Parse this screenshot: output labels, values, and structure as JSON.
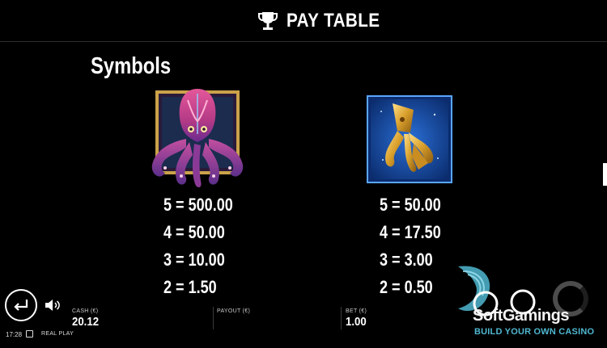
{
  "header": {
    "title": "PAY TABLE",
    "trophy_icon": "trophy-icon"
  },
  "section": {
    "title": "Symbols"
  },
  "symbols": [
    {
      "name": "kraken",
      "image_icon": "kraken-symbol",
      "pays": [
        {
          "text": "5 = 500.00"
        },
        {
          "text": "4 = 50.00"
        },
        {
          "text": "3 = 10.00"
        },
        {
          "text": "2 = 1.50"
        }
      ]
    },
    {
      "name": "gold squid",
      "image_icon": "gold-squid-symbol",
      "pays": [
        {
          "text": "5 = 50.00"
        },
        {
          "text": "4 = 17.50"
        },
        {
          "text": "3 = 3.00"
        },
        {
          "text": "2 = 0.50"
        }
      ]
    }
  ],
  "bottom_bar": {
    "cash_label": "CASH (€)",
    "cash_value": "20.12",
    "payout_label": "PAYOUT (€)",
    "payout_value": "",
    "bet_label": "BET (€)",
    "bet_value": "1.00",
    "time": "17:28",
    "mode": "REAL PLAY"
  },
  "watermark": {
    "brand": "SoftGamings",
    "tagline": "BUILD YOUR OWN CASINO"
  },
  "colors": {
    "background": "#000000",
    "text": "#ffffff",
    "watermark_accent": "#4fb7d0"
  }
}
